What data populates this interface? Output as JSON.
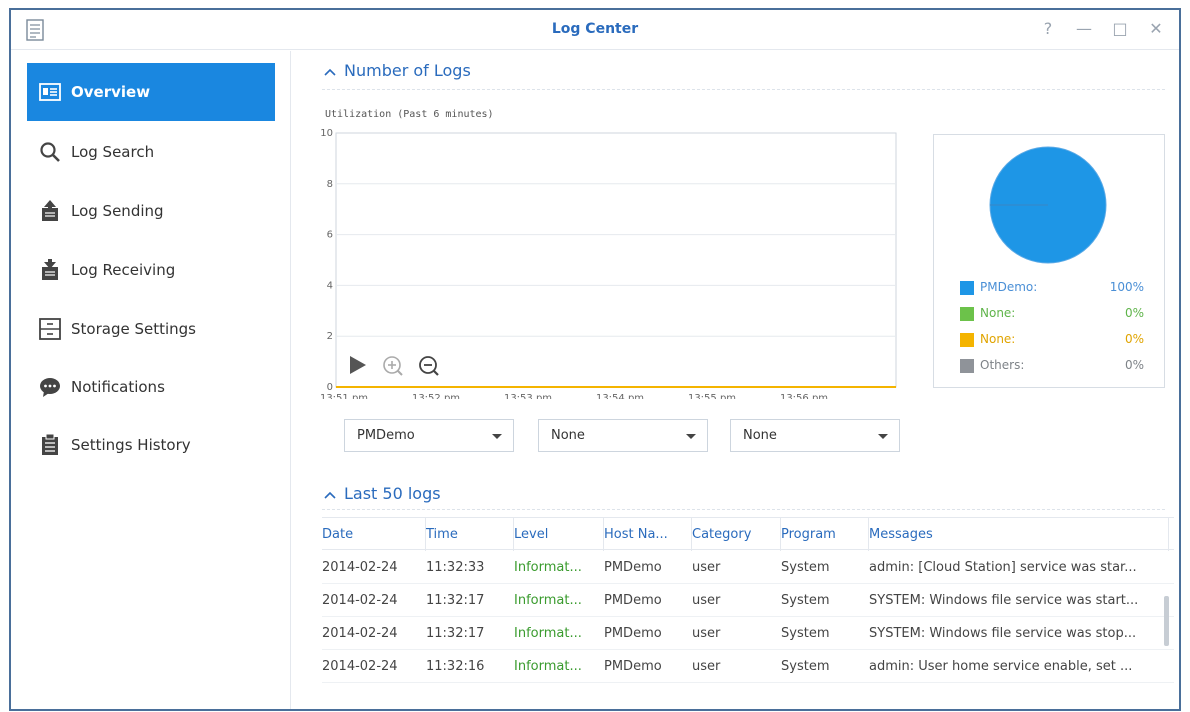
{
  "window": {
    "title": "Log Center",
    "controls": {
      "help": "?",
      "minimize": "—",
      "maximize": "□",
      "close": "✕"
    }
  },
  "sidebar": {
    "items": [
      {
        "label": "Overview",
        "icon": "overview-icon",
        "active": true
      },
      {
        "label": "Log Search",
        "icon": "search-icon",
        "active": false
      },
      {
        "label": "Log Sending",
        "icon": "log-sending-icon",
        "active": false
      },
      {
        "label": "Log Receiving",
        "icon": "log-receiving-icon",
        "active": false
      },
      {
        "label": "Storage Settings",
        "icon": "storage-settings-icon",
        "active": false
      },
      {
        "label": "Notifications",
        "icon": "notifications-icon",
        "active": false
      },
      {
        "label": "Settings History",
        "icon": "settings-history-icon",
        "active": false
      }
    ]
  },
  "main": {
    "number_of_logs": {
      "title": "Number of Logs"
    },
    "last_logs": {
      "title": "Last 50 logs"
    },
    "dropdowns": [
      "PMDemo",
      "None",
      "None"
    ]
  },
  "colors": {
    "accent": "#1a87e0",
    "title_blue": "#2a6bbd",
    "pmdemo": "#1e96e6",
    "none_green": "#6cc24a",
    "none_orange": "#f4b400",
    "others_gray": "#8f9399",
    "level_green": "#3a9b2e"
  },
  "chart_data": [
    {
      "type": "line",
      "title": "Utilization (Past 6 minutes)",
      "x": [
        "13:51 pm",
        "13:52 pm",
        "13:53 pm",
        "13:54 pm",
        "13:55 pm",
        "13:56 pm"
      ],
      "series": [
        {
          "values": [
            0,
            0,
            0,
            0,
            0,
            0
          ]
        }
      ],
      "ylim": [
        0,
        10
      ],
      "yticks": [
        0,
        2,
        4,
        6,
        8,
        10
      ],
      "grid": true,
      "controls": [
        "play-icon",
        "zoom-in-icon",
        "zoom-out-icon"
      ]
    },
    {
      "type": "pie",
      "slices": [
        {
          "name": "PMDemo:",
          "value": "100%",
          "percent": 100,
          "color": "#1e96e6"
        },
        {
          "name": "None:",
          "value": "0%",
          "percent": 0,
          "color": "#6cc24a"
        },
        {
          "name": "None:",
          "value": "0%",
          "percent": 0,
          "color": "#f4b400"
        },
        {
          "name": "Others:",
          "value": "0%",
          "percent": 0,
          "color": "#8f9399"
        }
      ]
    }
  ],
  "table": {
    "columns": [
      "Date",
      "Time",
      "Level",
      "Host Na...",
      "Category",
      "Program",
      "Messages"
    ],
    "rows": [
      [
        "2014-02-24",
        "11:32:33",
        "Informat...",
        "PMDemo",
        "user",
        "System",
        "admin: [Cloud Station] service was star..."
      ],
      [
        "2014-02-24",
        "11:32:17",
        "Informat...",
        "PMDemo",
        "user",
        "System",
        "SYSTEM: Windows file service was start..."
      ],
      [
        "2014-02-24",
        "11:32:17",
        "Informat...",
        "PMDemo",
        "user",
        "System",
        "SYSTEM: Windows file service was stop..."
      ],
      [
        "2014-02-24",
        "11:32:16",
        "Informat...",
        "PMDemo",
        "user",
        "System",
        "admin: User home service enable, set ..."
      ]
    ]
  }
}
